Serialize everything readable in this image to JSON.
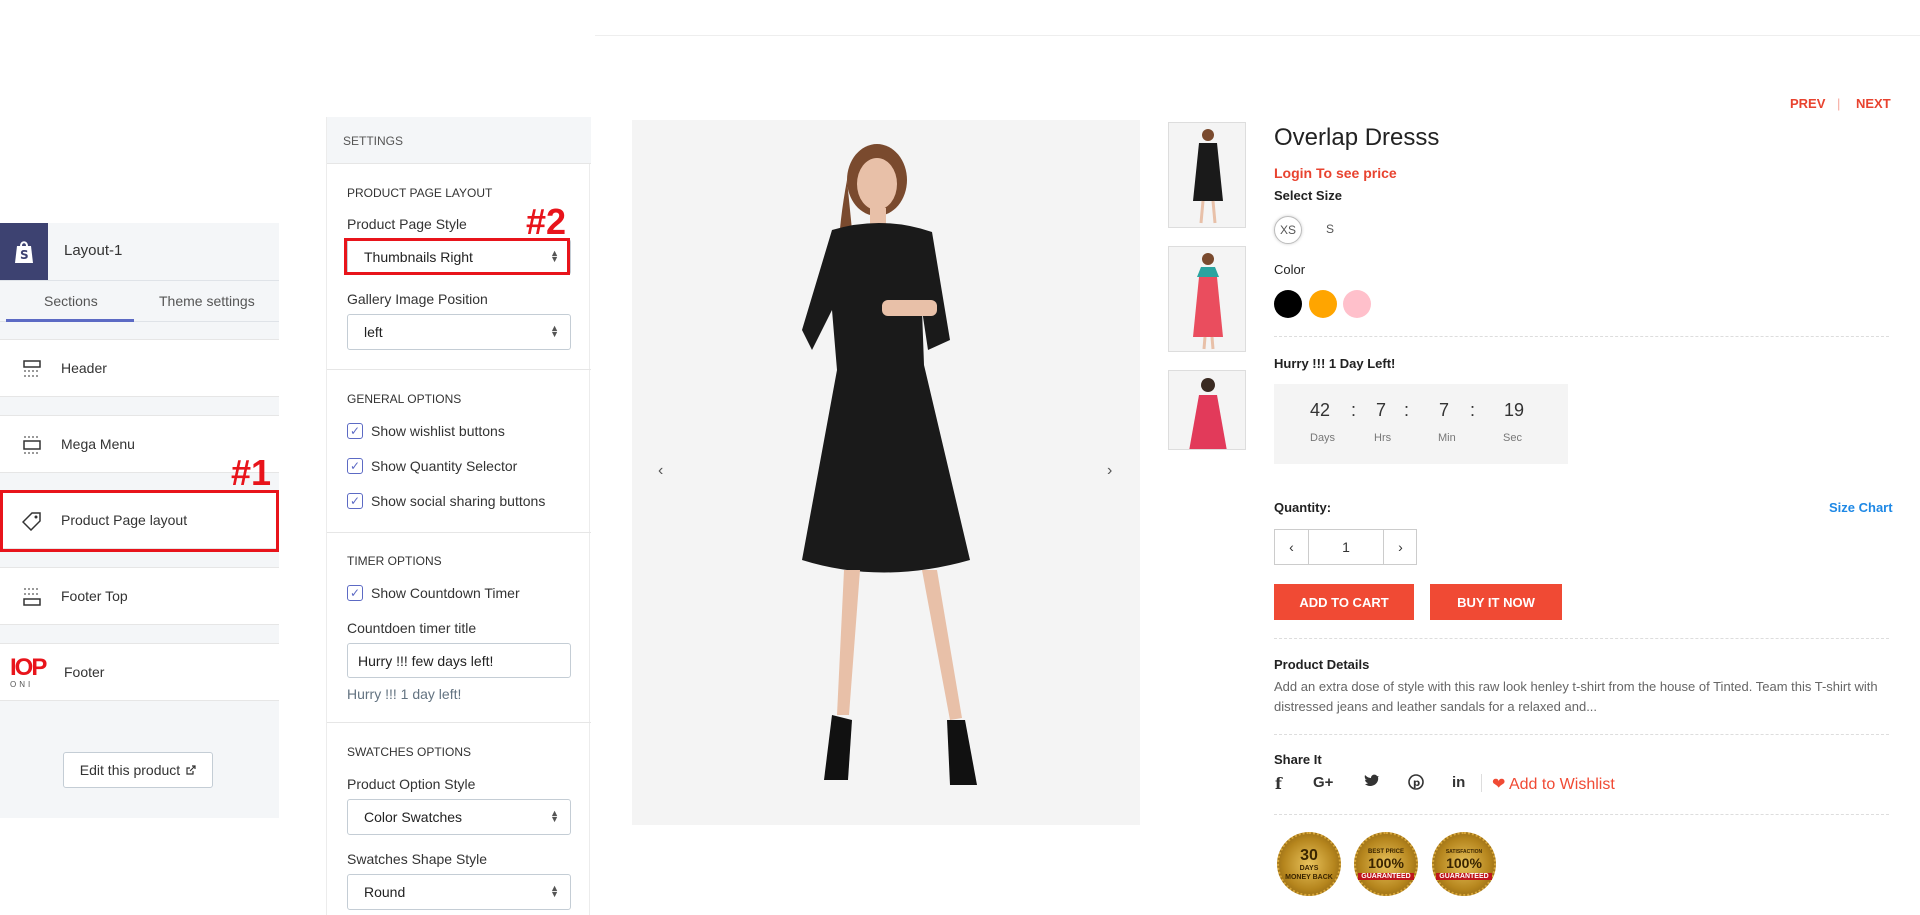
{
  "shopify_panel": {
    "layout_name": "Layout-1",
    "tabs": [
      "Sections",
      "Theme settings"
    ],
    "sections": [
      {
        "label": "Header",
        "icon": "header-icon"
      },
      {
        "label": "Mega Menu",
        "icon": "mega-menu-icon"
      },
      {
        "label": "Product Page layout",
        "icon": "tag-icon"
      },
      {
        "label": "Footer Top",
        "icon": "footer-top-icon"
      },
      {
        "label": "Footer",
        "icon": "footer-logo-image"
      }
    ],
    "edit_button": "Edit this product"
  },
  "annotations": {
    "one": "#1",
    "two": "#2"
  },
  "settings": {
    "title": "SETTINGS",
    "product_page_layout": {
      "heading": "PRODUCT PAGE LAYOUT",
      "style_label": "Product Page Style",
      "style_value": "Thumbnails Right",
      "gallery_label": "Gallery Image Position",
      "gallery_value": "left"
    },
    "general": {
      "heading": "GENERAL OPTIONS",
      "options": [
        "Show wishlist buttons",
        "Show Quantity Selector",
        "Show social sharing buttons"
      ]
    },
    "timer": {
      "heading": "TIMER OPTIONS",
      "show_label": "Show Countdown Timer",
      "title_label": "Countdoen timer title",
      "title_value": "Hurry !!! few days left!",
      "hint": "Hurry !!! 1 day left!"
    },
    "swatches": {
      "heading": "SWATCHES OPTIONS",
      "option_style_label": "Product Option Style",
      "option_style_value": "Color Swatches",
      "shape_label": "Swatches Shape Style",
      "shape_value": "Round"
    }
  },
  "product": {
    "prev": "PREV",
    "separator": "|",
    "next": "NEXT",
    "title": "Overlap Dresss",
    "login_price": "Login To see price",
    "select_size_label": "Select Size",
    "sizes": [
      "XS",
      "S"
    ],
    "color_label": "Color",
    "colors": [
      "#000000",
      "#ffa500",
      "#ffc0cb"
    ],
    "hurry": "Hurry !!! 1 Day Left!",
    "timer": {
      "days": "42",
      "hrs": "7",
      "min": "7",
      "sec": "19",
      "days_label": "Days",
      "hrs_label": "Hrs",
      "min_label": "Min",
      "sec_label": "Sec",
      "sep": ":"
    },
    "quantity_label": "Quantity:",
    "size_chart": "Size Chart",
    "quantity": "1",
    "add_to_cart": "ADD TO CART",
    "buy_now": "BUY IT NOW",
    "details_label": "Product Details",
    "details": "Add an extra dose of style with this raw look henley t-shirt from the house of Tinted. Team this T-shirt with distressed jeans and leather sandals for a relaxed and...",
    "share_label": "Share It",
    "wishlist": "Add to Wishlist",
    "badges": [
      {
        "top": "30",
        "sub": "DAYS",
        "rib": "MONEY BACK"
      },
      {
        "top": "100%",
        "sub": "BEST PRICE",
        "rib": "GUARANTEED"
      },
      {
        "top": "100%",
        "sub": "SATISFACTION",
        "rib": "GUARANTEED"
      }
    ]
  }
}
